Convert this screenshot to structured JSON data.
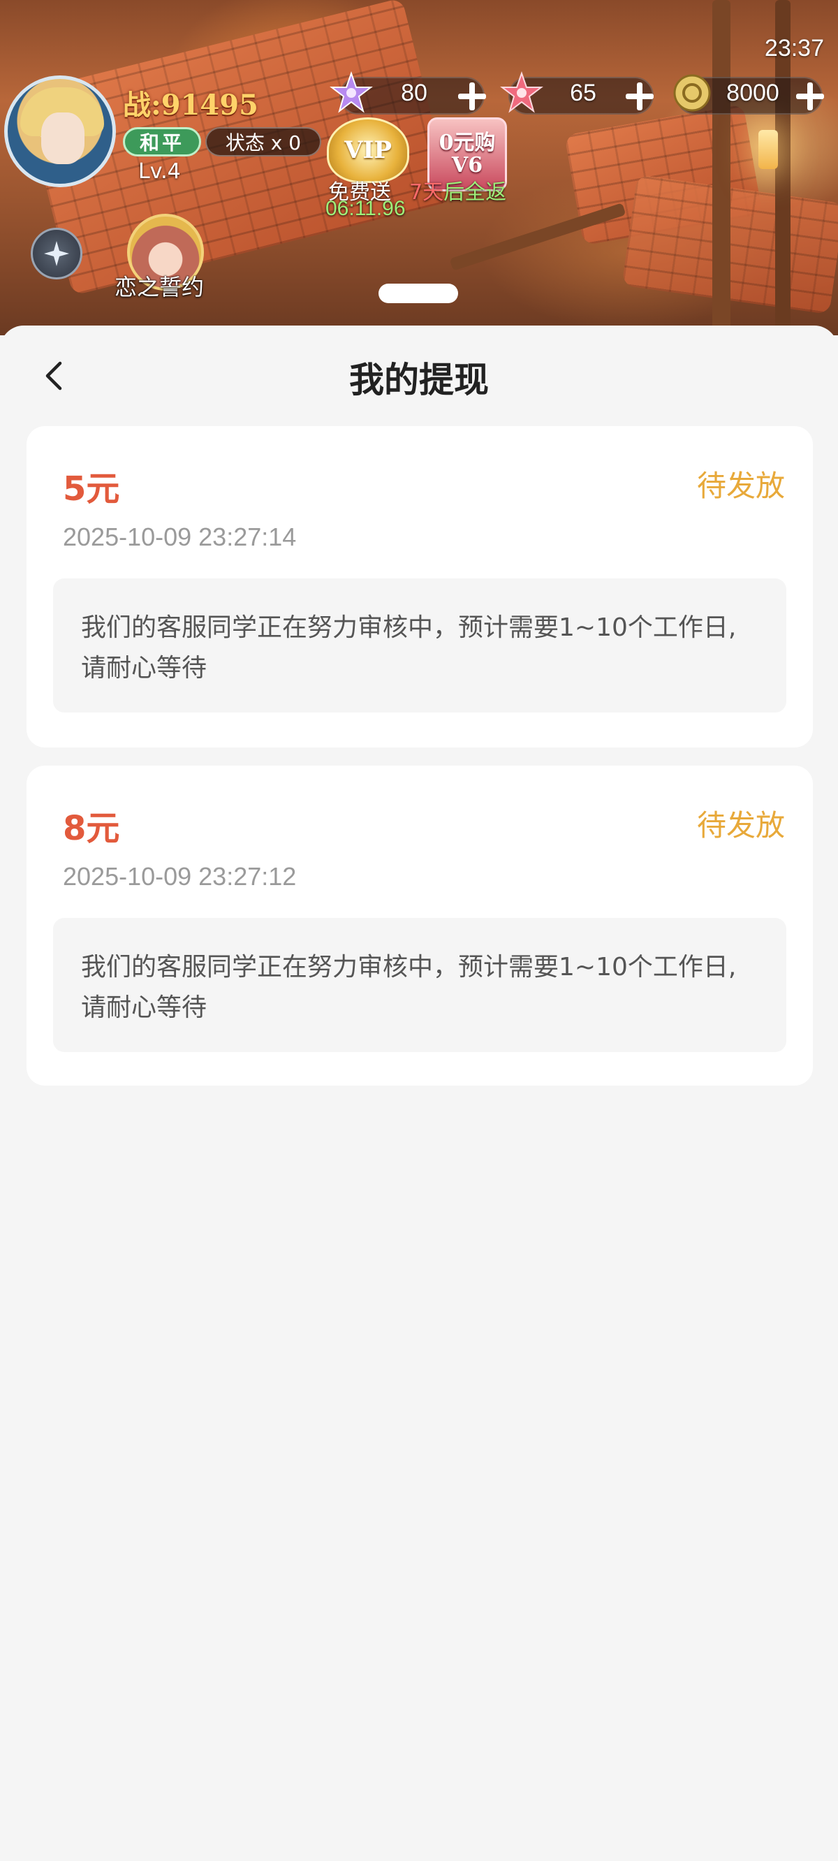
{
  "statusbar": {
    "time": "23:37"
  },
  "game_hud": {
    "power": "战:91495",
    "mode_badge": "和平",
    "status_badge": "状态 x 0",
    "level": "Lv.4",
    "resources": [
      {
        "icon": "purple-star-icon",
        "value": "80"
      },
      {
        "icon": "red-star-icon",
        "value": "65"
      },
      {
        "icon": "gold-coin-icon",
        "value": "8000"
      }
    ],
    "vip_badge": "VIP",
    "vip_label": "免费送",
    "vip_timer": "06:11.96",
    "zero_buy_badge": "0元购V6",
    "refund_label_prefix": "7天",
    "refund_label_suffix": "后全返",
    "event_label": "恋之誓约"
  },
  "page": {
    "title": "我的提现"
  },
  "withdrawals": [
    {
      "amount": "5元",
      "status": "待发放",
      "datetime": "2025-10-09 23:27:14",
      "note": "我们的客服同学正在努力审核中，预计需要1~10个工作日,请耐心等待"
    },
    {
      "amount": "8元",
      "status": "待发放",
      "datetime": "2025-10-09 23:27:12",
      "note": "我们的客服同学正在努力审核中，预计需要1~10个工作日,请耐心等待"
    }
  ],
  "colors": {
    "amount": "#e25a3c",
    "status": "#e8a93a",
    "background": "#f5f5f5"
  }
}
